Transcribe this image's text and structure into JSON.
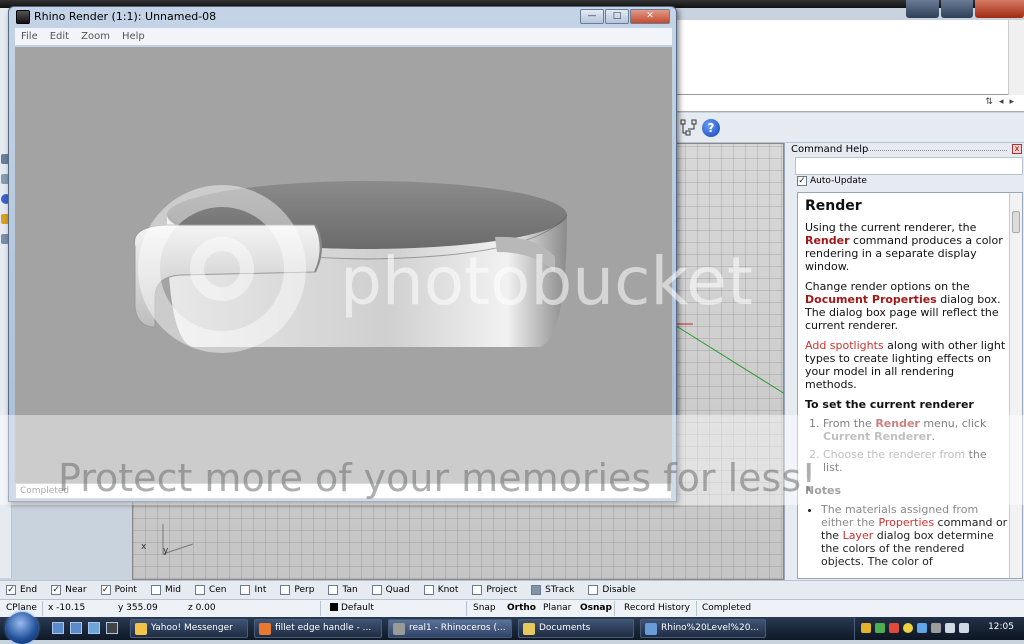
{
  "render_window": {
    "title": "Rhino Render (1:1): Unnamed-08",
    "menu": [
      "File",
      "Edit",
      "Zoom",
      "Help"
    ],
    "status": "Completed",
    "controls": {
      "minimize": "—",
      "maximize": "□",
      "close": "✕"
    }
  },
  "command_help": {
    "panel_title": "Command Help",
    "close_glyph": "x",
    "auto_update_label": "Auto-Update",
    "auto_update_checked": true,
    "heading": "Render",
    "para1_pre": "Using the current renderer, the ",
    "para1_kw": "Render",
    "para1_post": " command produces a color rendering in a separate display window.",
    "para2_pre": "Change render options on the ",
    "para2_link": "Document Properties",
    "para2_post": " dialog box. The dialog box page will reflect the current renderer.",
    "para3_link": "Add spotlights",
    "para3_post": " along with other light types to create lighting effects on your model in all rendering methods.",
    "section_title": "To set the current renderer",
    "step1_pre": "From the ",
    "step1_kw": "Render",
    "step1_mid": " menu, click ",
    "step1_kw2": "Current Renderer",
    "step1_post": ".",
    "step2_pre": "Choose the renderer from ",
    "step2_post": "the list.",
    "notes_title": "Notes",
    "note1_pre": "The materials assigned from either the ",
    "note1_link1": "Properties",
    "note1_mid": " command or the ",
    "note1_link2": "Layer",
    "note1_post": " dialog box determine the colors of the rendered objects. The color of"
  },
  "osnap": [
    {
      "label": "End",
      "checked": true
    },
    {
      "label": "Near",
      "checked": true
    },
    {
      "label": "Point",
      "checked": true
    },
    {
      "label": "Mid",
      "checked": false
    },
    {
      "label": "Cen",
      "checked": false
    },
    {
      "label": "Int",
      "checked": false
    },
    {
      "label": "Perp",
      "checked": false
    },
    {
      "label": "Tan",
      "checked": false
    },
    {
      "label": "Quad",
      "checked": false
    },
    {
      "label": "Knot",
      "checked": false
    },
    {
      "label": "Project",
      "checked": false
    },
    {
      "label": "STrack",
      "checked": false
    },
    {
      "label": "Disable",
      "checked": false
    }
  ],
  "status_bar": {
    "cplane": "CPlane",
    "x": "x -10.15",
    "y": "y 355.09",
    "z": "z 0.00",
    "layer": "Default",
    "snap": "Snap",
    "ortho": "Ortho",
    "planar": "Planar",
    "osnap": "Osnap",
    "record_history": "Record History",
    "last": "Completed"
  },
  "viewport": {
    "axis_x": "x",
    "axis_y": "y"
  },
  "taskbar": {
    "items": [
      {
        "label": "Yahoo! Messenger",
        "active": false
      },
      {
        "label": "fillet edge handle - ...",
        "active": false
      },
      {
        "label": "real1 - Rhinoceros (...",
        "active": true
      },
      {
        "label": "Documents",
        "active": false
      },
      {
        "label": "Rhino%20Level%20...",
        "active": false
      }
    ],
    "clock": "12:05"
  },
  "watermark": {
    "logo_text": "photobucket",
    "strip_text": "Protect more of your memories for less!"
  },
  "colors": {
    "accent": "#a01818",
    "taskbar": "#1a2638"
  }
}
